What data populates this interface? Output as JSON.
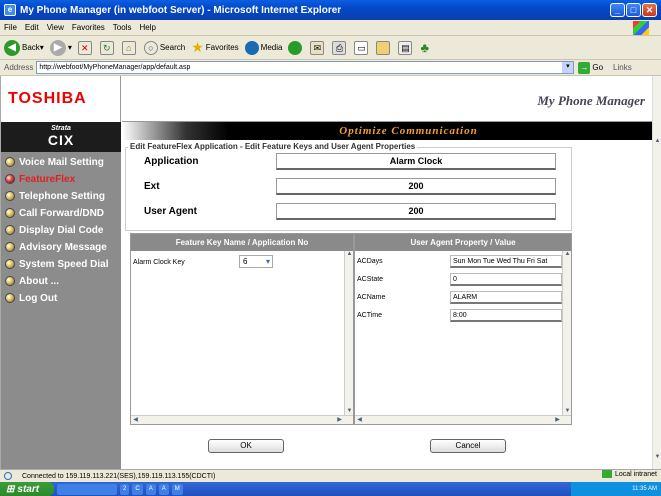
{
  "window": {
    "title": "My Phone Manager (in webfoot Server) - Microsoft Internet Explorer"
  },
  "menu": [
    "File",
    "Edit",
    "View",
    "Favorites",
    "Tools",
    "Help"
  ],
  "toolbar": {
    "back": "Back",
    "search": "Search",
    "favorites": "Favorites",
    "media": "Media"
  },
  "address": {
    "label": "Address",
    "url": "http://webfoot/MyPhoneManager/app/default.asp",
    "go": "Go",
    "links": "Links"
  },
  "header": {
    "logo": "TOSHIBA",
    "app_title": "My Phone Manager",
    "strata_top": "Strata",
    "strata_bottom": "CIX",
    "banner": "Optimize Communication"
  },
  "sidebar": {
    "items": [
      {
        "label": "Voice Mail Setting",
        "active": false
      },
      {
        "label": "FeatureFlex",
        "active": true
      },
      {
        "label": "Telephone Setting",
        "active": false
      },
      {
        "label": "Call Forward/DND",
        "active": false
      },
      {
        "label": "Display Dial Code",
        "active": false
      },
      {
        "label": "Advisory Message",
        "active": false
      },
      {
        "label": "System Speed Dial",
        "active": false
      },
      {
        "label": "About ...",
        "active": false
      },
      {
        "label": "Log Out",
        "active": false
      }
    ]
  },
  "form": {
    "legend": "Edit FeatureFlex Application - Edit Feature Keys and User Agent Properties",
    "application_label": "Application",
    "application_value": "Alarm Clock",
    "ext_label": "Ext",
    "ext_value": "200",
    "agent_label": "User Agent",
    "agent_value": "200"
  },
  "left_panel": {
    "header": "Feature Key Name / Application No",
    "rows": [
      {
        "name": "Alarm Clock Key",
        "value": "6"
      }
    ]
  },
  "right_panel": {
    "header": "User Agent Property / Value",
    "rows": [
      {
        "name": "ACDays",
        "value": "Sun Mon Tue Wed Thu Fri Sat"
      },
      {
        "name": "ACState",
        "value": "0"
      },
      {
        "name": "ACName",
        "value": "ALARM"
      },
      {
        "name": "ACTime",
        "value": "8:00"
      }
    ]
  },
  "buttons": {
    "ok": "OK",
    "cancel": "Cancel"
  },
  "status": {
    "text": "Connected to 159.119.113.221(SES),159.119.113.155(CDCTI)",
    "zone": "Local intranet"
  },
  "taskbar": {
    "start": "start",
    "time": "11:35 AM",
    "tasks": [
      "2",
      "C",
      "A",
      "A",
      "M"
    ]
  }
}
